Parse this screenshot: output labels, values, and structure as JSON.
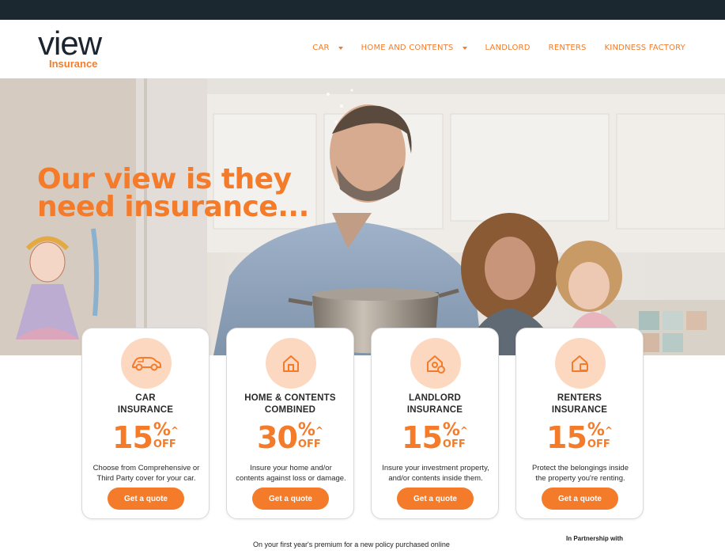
{
  "header": {
    "logo_word": "view",
    "logo_sub": "Insurance",
    "nav": [
      {
        "label": "CAR",
        "has_dropdown": true
      },
      {
        "label": "HOME AND CONTENTS",
        "has_dropdown": true
      },
      {
        "label": "LANDLORD",
        "has_dropdown": false
      },
      {
        "label": "RENTERS",
        "has_dropdown": false
      },
      {
        "label": "KINDNESS FACTORY",
        "has_dropdown": false
      }
    ]
  },
  "hero": {
    "title_line1": "Our view is they",
    "title_line2": "need insurance..."
  },
  "cards": [
    {
      "icon": "car-icon",
      "title_line1": "CAR",
      "title_line2": "INSURANCE",
      "discount": "15",
      "percent": "%",
      "caret": "^",
      "off": "OFF",
      "desc_line1": "Choose from Comprehensive or",
      "desc_line2": "Third Party cover for your car.",
      "button": "Get a quote"
    },
    {
      "icon": "home-icon",
      "title_line1": "HOME & CONTENTS",
      "title_line2": "COMBINED",
      "discount": "30",
      "percent": "%",
      "caret": "^",
      "off": "OFF",
      "desc_line1": "Insure your home and/or",
      "desc_line2": "contents against loss or damage.",
      "button": "Get a quote"
    },
    {
      "icon": "landlord-house-icon",
      "title_line1": "LANDLORD",
      "title_line2": "INSURANCE",
      "discount": "15",
      "percent": "%",
      "caret": "^",
      "off": "OFF",
      "desc_line1": "Insure your investment property,",
      "desc_line2": "and/or contents inside them.",
      "button": "Get a quote"
    },
    {
      "icon": "renters-house-icon",
      "title_line1": "RENTERS",
      "title_line2": "INSURANCE",
      "discount": "15",
      "percent": "%",
      "caret": "^",
      "off": "OFF",
      "desc_line1": "Protect the belongings inside",
      "desc_line2": "the property you're renting.",
      "button": "Get a quote"
    }
  ],
  "footnote": "On your first year's premium for a new policy purchased online",
  "partner": "In Partnership with",
  "colors": {
    "accent": "#f47b2a",
    "dark": "#1c2830",
    "icon_bg": "#fdd8c0"
  }
}
